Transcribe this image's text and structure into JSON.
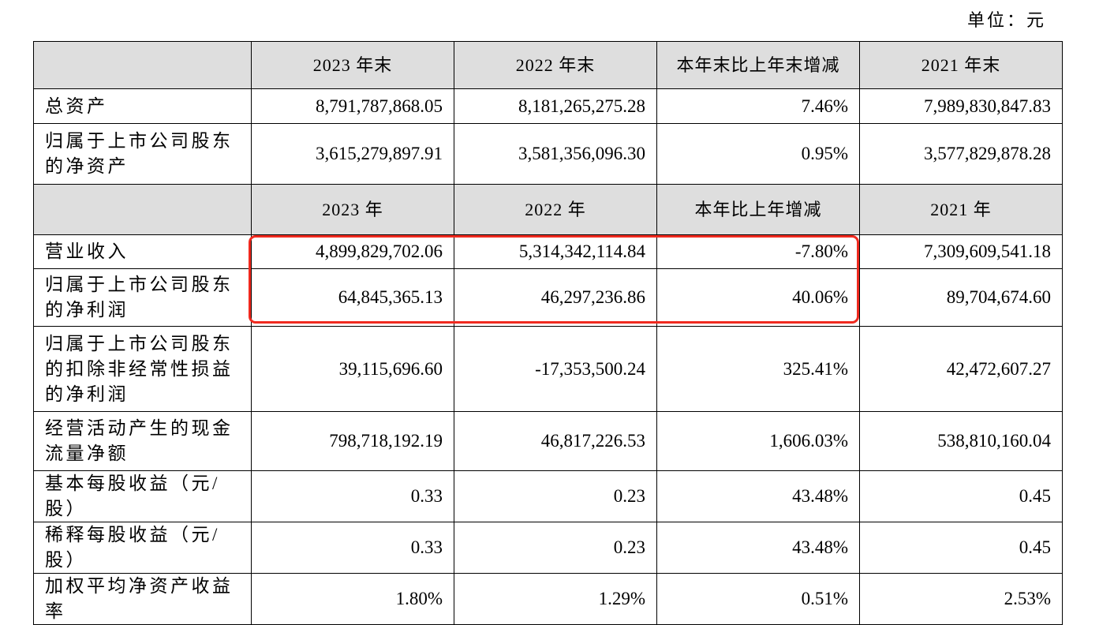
{
  "unit_label": "单位：元",
  "balance_header": [
    "",
    "2023 年末",
    "2022 年末",
    "本年末比上年末增减",
    "2021 年末"
  ],
  "balance_rows": [
    {
      "label": "总资产",
      "values": [
        "8,791,787,868.05",
        "8,181,265,275.28",
        "7.46%",
        "7,989,830,847.83"
      ]
    },
    {
      "label": "归属于上市公司股东的净资产",
      "values": [
        "3,615,279,897.91",
        "3,581,356,096.30",
        "0.95%",
        "3,577,829,878.28"
      ]
    }
  ],
  "income_header": [
    "",
    "2023 年",
    "2022 年",
    "本年比上年增减",
    "2021 年"
  ],
  "income_rows": [
    {
      "label": "营业收入",
      "values": [
        "4,899,829,702.06",
        "5,314,342,114.84",
        "-7.80%",
        "7,309,609,541.18"
      ]
    },
    {
      "label": "归属于上市公司股东的净利润",
      "values": [
        "64,845,365.13",
        "46,297,236.86",
        "40.06%",
        "89,704,674.60"
      ]
    },
    {
      "label": "归属于上市公司股东的扣除非经常性损益的净利润",
      "values": [
        "39,115,696.60",
        "-17,353,500.24",
        "325.41%",
        "42,472,607.27"
      ]
    },
    {
      "label": "经营活动产生的现金流量净额",
      "values": [
        "798,718,192.19",
        "46,817,226.53",
        "1,606.03%",
        "538,810,160.04"
      ]
    },
    {
      "label": "基本每股收益（元/股）",
      "values": [
        "0.33",
        "0.23",
        "43.48%",
        "0.45"
      ]
    },
    {
      "label": "稀释每股收益（元/股）",
      "values": [
        "0.33",
        "0.23",
        "43.48%",
        "0.45"
      ]
    },
    {
      "label": "加权平均净资产收益率",
      "values": [
        "1.80%",
        "1.29%",
        "0.51%",
        "2.53%"
      ]
    }
  ],
  "highlight_color": "#f02a1f"
}
